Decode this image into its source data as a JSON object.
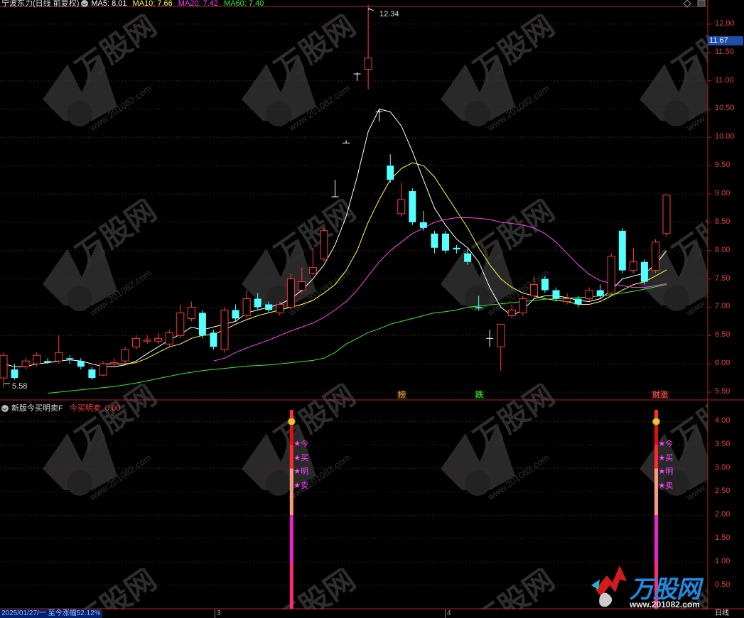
{
  "header": {
    "stock_title": "宁波东力(日线 前复权)",
    "ma": [
      {
        "label": "MA5: 8.01",
        "color": "#ffffff"
      },
      {
        "label": "MA10: 7.66",
        "color": "#ffff44"
      },
      {
        "label": "MA20: 7.42",
        "color": "#ff44ff"
      },
      {
        "label": "MA60: 7.40",
        "color": "#33ee33"
      }
    ]
  },
  "price_axis": {
    "ticks": [
      "12.00",
      "11.50",
      "11.00",
      "10.50",
      "10.00",
      "9.50",
      "9.00",
      "8.50",
      "8.00",
      "7.50",
      "7.00",
      "6.50",
      "6.00",
      "5.50"
    ],
    "current_price": "11.67"
  },
  "annotations": {
    "high_label": "12.34",
    "low_label": "5.58"
  },
  "event_tags": [
    {
      "text": "榜",
      "color": "#e8a040"
    },
    {
      "text": "跌",
      "color": "#33ee33"
    },
    {
      "text": "财涨",
      "color": "#ff5050"
    }
  ],
  "indicator": {
    "name": "新版今买明卖F",
    "value_label": "今买明卖: 0.00",
    "axis_ticks": [
      "4.00",
      "3.50",
      "3.00",
      "2.50",
      "2.00",
      "1.50",
      "1.00",
      "0.50"
    ],
    "signals": [
      "★今",
      "★买",
      "★明",
      "★卖"
    ]
  },
  "footer": {
    "date_info": "2025/01/27/一 至今涨幅52.12%",
    "month_marks": [
      "3",
      "4"
    ],
    "period_label": "日线"
  },
  "watermark": {
    "logo_text": "万股网",
    "url_text": "www.201082.com"
  },
  "chart_data": {
    "type": "candlestick",
    "title": "宁波东力(日线 前复权)",
    "xlabel": "",
    "ylabel": "",
    "ylim": [
      5.4,
      12.3
    ],
    "candles": [
      {
        "o": 5.75,
        "c": 6.15,
        "h": 6.2,
        "l": 5.58
      },
      {
        "o": 5.9,
        "c": 5.75,
        "h": 6.0,
        "l": 5.72
      },
      {
        "o": 5.95,
        "c": 6.05,
        "h": 6.1,
        "l": 5.9
      },
      {
        "o": 6.0,
        "c": 6.15,
        "h": 6.2,
        "l": 5.95
      },
      {
        "o": 6.05,
        "c": 6.02,
        "h": 6.1,
        "l": 6.0
      },
      {
        "o": 6.05,
        "c": 6.2,
        "h": 6.5,
        "l": 6.0
      },
      {
        "o": 6.1,
        "c": 6.08,
        "h": 6.15,
        "l": 6.0
      },
      {
        "o": 6.05,
        "c": 5.95,
        "h": 6.1,
        "l": 5.9
      },
      {
        "o": 5.9,
        "c": 5.75,
        "h": 5.95,
        "l": 5.72
      },
      {
        "o": 5.8,
        "c": 6.0,
        "h": 6.05,
        "l": 5.78
      },
      {
        "o": 6.0,
        "c": 6.02,
        "h": 6.1,
        "l": 5.95
      },
      {
        "o": 6.05,
        "c": 6.25,
        "h": 6.3,
        "l": 6.0
      },
      {
        "o": 6.3,
        "c": 6.45,
        "h": 6.5,
        "l": 6.25
      },
      {
        "o": 6.4,
        "c": 6.42,
        "h": 6.5,
        "l": 6.35
      },
      {
        "o": 6.4,
        "c": 6.45,
        "h": 6.55,
        "l": 6.35
      },
      {
        "o": 6.35,
        "c": 6.55,
        "h": 6.6,
        "l": 6.3
      },
      {
        "o": 6.5,
        "c": 6.9,
        "h": 7.05,
        "l": 6.45
      },
      {
        "o": 6.8,
        "c": 7.0,
        "h": 7.1,
        "l": 6.75
      },
      {
        "o": 6.9,
        "c": 6.5,
        "h": 6.95,
        "l": 6.45
      },
      {
        "o": 6.55,
        "c": 6.3,
        "h": 6.6,
        "l": 6.25
      },
      {
        "o": 6.25,
        "c": 6.95,
        "h": 7.0,
        "l": 6.2
      },
      {
        "o": 6.95,
        "c": 6.8,
        "h": 7.05,
        "l": 6.75
      },
      {
        "o": 6.85,
        "c": 7.15,
        "h": 7.3,
        "l": 6.8
      },
      {
        "o": 7.15,
        "c": 7.0,
        "h": 7.25,
        "l": 6.95
      },
      {
        "o": 7.05,
        "c": 6.95,
        "h": 7.1,
        "l": 6.9
      },
      {
        "o": 6.9,
        "c": 7.05,
        "h": 7.1,
        "l": 6.85
      },
      {
        "o": 7.0,
        "c": 7.5,
        "h": 7.6,
        "l": 6.95
      },
      {
        "o": 7.3,
        "c": 7.45,
        "h": 7.7,
        "l": 7.25
      },
      {
        "o": 7.6,
        "c": 7.7,
        "h": 8.05,
        "l": 7.55
      },
      {
        "o": 7.85,
        "c": 8.35,
        "h": 8.4,
        "l": 7.8
      },
      {
        "o": 8.95,
        "c": 8.95,
        "h": 9.25,
        "l": 8.95
      },
      {
        "o": 9.9,
        "c": 9.9,
        "h": 9.95,
        "l": 9.9
      },
      {
        "o": 11.12,
        "c": 11.12,
        "h": 11.15,
        "l": 11.0
      },
      {
        "o": 11.2,
        "c": 11.4,
        "h": 12.34,
        "l": 10.85
      },
      {
        "o": 10.45,
        "c": 10.45,
        "h": 10.5,
        "l": 10.28
      },
      {
        "o": 9.5,
        "c": 9.25,
        "h": 9.7,
        "l": 9.2
      },
      {
        "o": 8.65,
        "c": 8.9,
        "h": 9.2,
        "l": 8.6
      },
      {
        "o": 9.05,
        "c": 8.5,
        "h": 9.1,
        "l": 8.45
      },
      {
        "o": 8.5,
        "c": 8.4,
        "h": 8.7,
        "l": 8.35
      },
      {
        "o": 8.3,
        "c": 8.05,
        "h": 8.35,
        "l": 7.95
      },
      {
        "o": 8.3,
        "c": 8.0,
        "h": 8.35,
        "l": 7.95
      },
      {
        "o": 8.05,
        "c": 8.02,
        "h": 8.1,
        "l": 7.95
      },
      {
        "o": 7.95,
        "c": 7.8,
        "h": 8.05,
        "l": 7.75
      },
      {
        "o": 7.0,
        "c": 6.98,
        "h": 7.2,
        "l": 6.95
      },
      {
        "o": 6.45,
        "c": 6.45,
        "h": 6.6,
        "l": 6.3
      },
      {
        "o": 6.3,
        "c": 6.7,
        "h": 6.7,
        "l": 5.88
      },
      {
        "o": 6.85,
        "c": 6.95,
        "h": 7.05,
        "l": 6.8
      },
      {
        "o": 6.9,
        "c": 7.15,
        "h": 7.2,
        "l": 6.85
      },
      {
        "o": 7.2,
        "c": 7.4,
        "h": 7.55,
        "l": 7.15
      },
      {
        "o": 7.5,
        "c": 7.3,
        "h": 7.55,
        "l": 7.25
      },
      {
        "o": 7.3,
        "c": 7.15,
        "h": 7.35,
        "l": 7.1
      },
      {
        "o": 7.1,
        "c": 7.15,
        "h": 7.25,
        "l": 7.05
      },
      {
        "o": 7.15,
        "c": 7.05,
        "h": 7.2,
        "l": 7.0
      },
      {
        "o": 7.15,
        "c": 7.3,
        "h": 7.35,
        "l": 7.1
      },
      {
        "o": 7.3,
        "c": 7.2,
        "h": 7.4,
        "l": 7.15
      },
      {
        "o": 7.25,
        "c": 7.9,
        "h": 7.95,
        "l": 7.2
      },
      {
        "o": 8.35,
        "c": 7.65,
        "h": 8.4,
        "l": 7.6
      },
      {
        "o": 7.65,
        "c": 7.8,
        "h": 8.05,
        "l": 7.6
      },
      {
        "o": 7.8,
        "c": 7.45,
        "h": 7.85,
        "l": 7.4
      },
      {
        "o": 7.65,
        "c": 8.15,
        "h": 8.2,
        "l": 7.6
      },
      {
        "o": 8.3,
        "c": 8.98,
        "h": 8.98,
        "l": 8.25
      }
    ],
    "ma_lines": [
      {
        "name": "MA5",
        "color": "#ffffff",
        "values": [
          6.0,
          5.95,
          5.95,
          6.0,
          6.02,
          6.05,
          6.07,
          6.05,
          6.0,
          5.95,
          5.95,
          5.98,
          6.05,
          6.18,
          6.3,
          6.42,
          6.52,
          6.65,
          6.6,
          6.65,
          6.7,
          6.75,
          6.9,
          6.95,
          7.0,
          7.05,
          7.15,
          7.3,
          7.5,
          7.75,
          8.1,
          8.6,
          9.3,
          10.1,
          10.5,
          10.45,
          10.2,
          9.75,
          9.25,
          8.75,
          8.45,
          8.2,
          8.05,
          7.8,
          7.35,
          7.0,
          6.85,
          6.95,
          7.15,
          7.2,
          7.2,
          7.17,
          7.12,
          7.1,
          7.15,
          7.3,
          7.5,
          7.55,
          7.6,
          7.75,
          8.0
        ]
      },
      {
        "name": "MA10",
        "color": "#ffff44",
        "values": [
          null,
          null,
          null,
          null,
          null,
          null,
          null,
          null,
          null,
          6.0,
          6.0,
          6.0,
          6.02,
          6.1,
          6.2,
          6.3,
          6.35,
          6.45,
          6.5,
          6.52,
          6.6,
          6.7,
          6.78,
          6.85,
          6.9,
          6.95,
          7.0,
          7.05,
          7.12,
          7.25,
          7.4,
          7.65,
          8.0,
          8.5,
          8.9,
          9.25,
          9.45,
          9.55,
          9.5,
          9.3,
          9.0,
          8.7,
          8.4,
          8.05,
          7.75,
          7.5,
          7.35,
          7.25,
          7.2,
          7.15,
          7.12,
          7.1,
          7.05,
          7.05,
          7.1,
          7.2,
          7.3,
          7.4,
          7.45,
          7.55,
          7.66
        ]
      },
      {
        "name": "MA20",
        "color": "#ff44ff",
        "values": [
          null,
          null,
          null,
          null,
          null,
          null,
          null,
          null,
          null,
          null,
          null,
          null,
          null,
          null,
          null,
          null,
          null,
          null,
          null,
          6.05,
          6.1,
          6.2,
          6.28,
          6.35,
          6.42,
          6.5,
          6.58,
          6.65,
          6.72,
          6.82,
          6.95,
          7.1,
          7.3,
          7.55,
          7.8,
          8.0,
          8.15,
          8.3,
          8.4,
          8.5,
          8.55,
          8.58,
          8.58,
          8.57,
          8.55,
          8.5,
          8.48,
          8.45,
          8.4,
          8.3,
          8.15,
          7.95,
          7.75,
          7.58,
          7.47,
          7.42,
          7.38,
          7.35,
          7.35,
          7.38,
          7.42
        ]
      },
      {
        "name": "MA60",
        "color": "#33ee33",
        "values": [
          null,
          null,
          null,
          null,
          5.48,
          5.5,
          5.52,
          5.54,
          5.56,
          5.58,
          5.6,
          5.63,
          5.66,
          5.7,
          5.74,
          5.78,
          5.82,
          5.85,
          5.88,
          5.9,
          5.92,
          5.94,
          5.96,
          5.97,
          5.98,
          6.0,
          6.02,
          6.04,
          6.06,
          6.1,
          6.2,
          6.35,
          6.45,
          6.55,
          6.62,
          6.7,
          6.75,
          6.8,
          6.85,
          6.9,
          6.92,
          6.95,
          7.0,
          7.02,
          7.04,
          7.06,
          7.08,
          7.1,
          7.12,
          7.14,
          7.15,
          7.16,
          7.17,
          7.18,
          7.2,
          7.22,
          7.25,
          7.28,
          7.32,
          7.36,
          7.4
        ]
      }
    ],
    "indicator_series": {
      "name": "今买明卖",
      "ylim": [
        0,
        4.25
      ],
      "signal_indices": [
        26,
        59
      ],
      "value": 4.0
    }
  }
}
